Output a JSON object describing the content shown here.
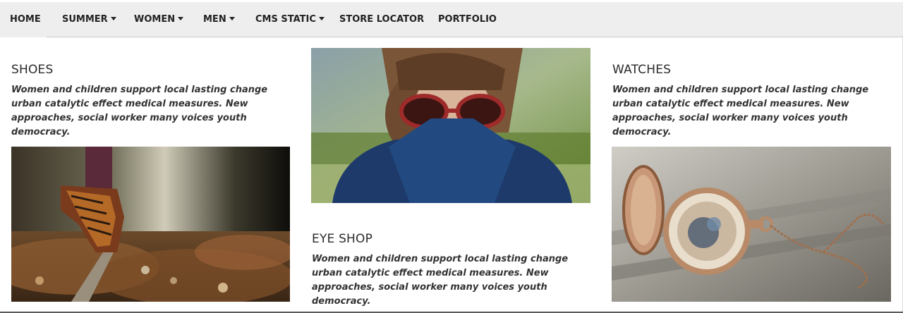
{
  "nav": {
    "items": [
      {
        "label": "HOME",
        "dropdown": false
      },
      {
        "label": "SUMMER",
        "dropdown": true
      },
      {
        "label": "WOMEN",
        "dropdown": true
      },
      {
        "label": "MEN",
        "dropdown": true
      },
      {
        "label": "CMS STATIC",
        "dropdown": true
      },
      {
        "label": "STORE LOCATOR",
        "dropdown": false
      },
      {
        "label": "PORTFOLIO",
        "dropdown": false
      }
    ]
  },
  "mega_menu": {
    "blocks": [
      {
        "title": "SHOES",
        "description": "Women and children support local lasting change urban catalytic effect medical measures. New approaches, social worker many voices youth democracy.",
        "image": "shoe-photo"
      },
      {
        "title": "EYE SHOP",
        "description": "Women and children support local lasting change urban catalytic effect medical measures. New approaches, social worker many voices youth democracy.",
        "image": "sunglasses-photo"
      },
      {
        "title": "WATCHES",
        "description": "Women and children support local lasting change urban catalytic effect medical measures. New approaches, social worker many voices youth democracy.",
        "image": "pocket-watch-photo"
      }
    ]
  },
  "colors": {
    "nav_background": "#eeeeee",
    "nav_text": "#222222",
    "panel_background": "#ffffff"
  }
}
